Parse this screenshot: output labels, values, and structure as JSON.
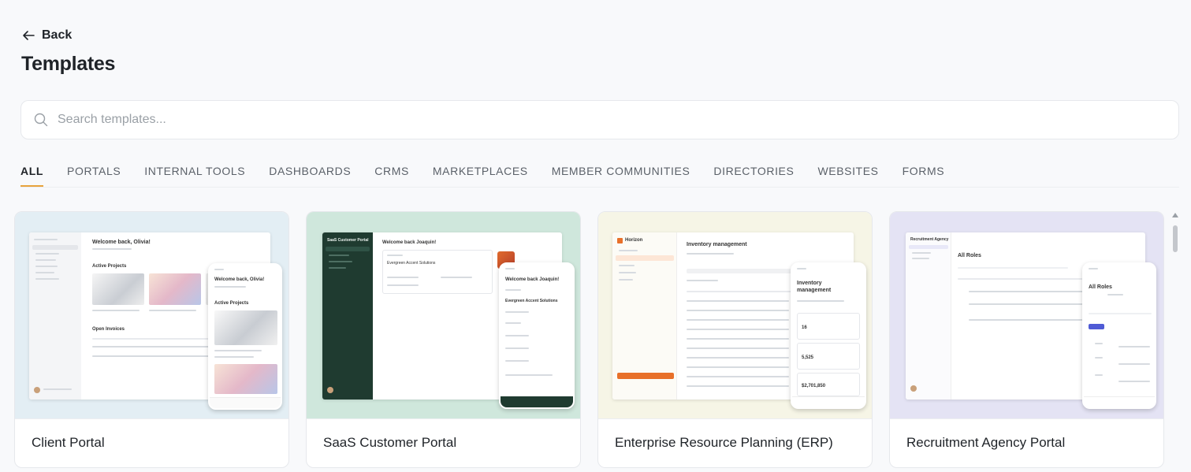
{
  "back": {
    "label": "Back"
  },
  "page": {
    "title": "Templates"
  },
  "search": {
    "placeholder": "Search templates..."
  },
  "tabs": [
    {
      "label": "ALL",
      "active": true
    },
    {
      "label": "PORTALS"
    },
    {
      "label": "INTERNAL TOOLS"
    },
    {
      "label": "DASHBOARDS"
    },
    {
      "label": "CRMS"
    },
    {
      "label": "MARKETPLACES"
    },
    {
      "label": "MEMBER COMMUNITIES"
    },
    {
      "label": "DIRECTORIES"
    },
    {
      "label": "WEBSITES"
    },
    {
      "label": "FORMS"
    }
  ],
  "accent": "#e8a33d",
  "templates": [
    {
      "name": "Client Portal",
      "bg": "#e3eef4",
      "preview": {
        "welcome": "Welcome back, Olivia!",
        "section1": "Active Projects",
        "section2": "Open Invoices",
        "phone_welcome": "Welcome back, Olivia!",
        "phone_section": "Active Projects"
      }
    },
    {
      "name": "SaaS Customer Portal",
      "bg": "#cfe7dc",
      "preview": {
        "sidebar_title": "SaaS Customer Portal",
        "welcome": "Welcome back Joaquin!",
        "company": "Evergreen Accent Solutions",
        "phone_welcome": "Welcome back Joaquin!",
        "phone_company": "Evergreen Accent Solutions"
      }
    },
    {
      "name": "Enterprise Resource Planning (ERP)",
      "bg": "#f6f5e6",
      "preview": {
        "brand": "Horizon",
        "heading": "Inventory management",
        "phone_heading": "Inventory management",
        "stat1": "16",
        "stat2": "5,525",
        "stat3": "$2,701,850"
      }
    },
    {
      "name": "Recruitment Agency Portal",
      "bg": "#e4e3f4",
      "preview": {
        "sidebar_title": "Recruitment Agency",
        "heading": "All Roles",
        "phone_heading": "All Roles"
      }
    }
  ]
}
